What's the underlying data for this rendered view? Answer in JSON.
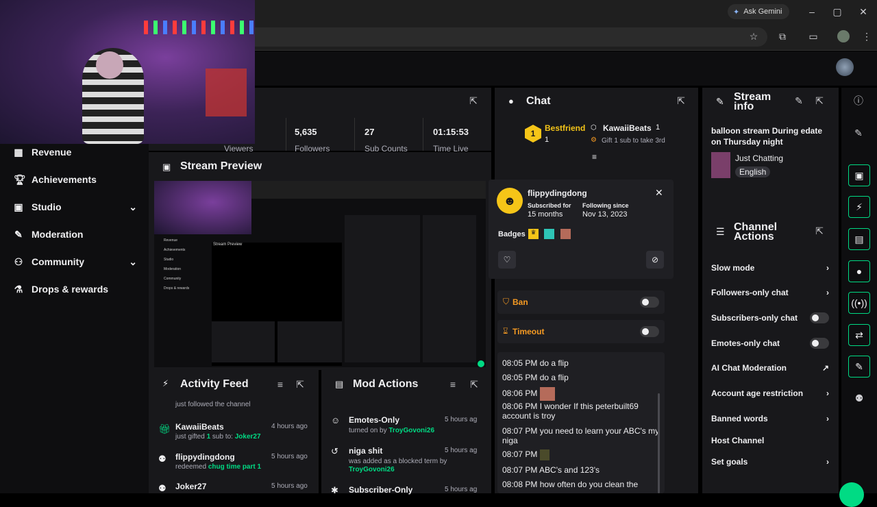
{
  "browser": {
    "ask_gemini": "Ask Gemini"
  },
  "sidebar": {
    "items": [
      {
        "label": "Revenue",
        "icon": "revenue-icon"
      },
      {
        "label": "Achievements",
        "icon": "trophy-icon"
      },
      {
        "label": "Studio",
        "icon": "studio-icon"
      },
      {
        "label": "Moderation",
        "icon": "wrench-icon"
      },
      {
        "label": "Community",
        "icon": "community-icon"
      },
      {
        "label": "Drops & rewards",
        "icon": "drops-icon"
      }
    ]
  },
  "stats": {
    "followers_num": "5,635",
    "subs_num": "27",
    "time_live": "01:15:53",
    "viewers_lbl": "Viewers",
    "followers_lbl": "Followers",
    "subs_lbl": "Sub Counts",
    "time_lbl": "Time Live"
  },
  "stream_preview": {
    "title": "Stream Preview"
  },
  "chat": {
    "title": "Chat",
    "pinned": {
      "rank": "1",
      "label": "Bestfriend",
      "count": "1",
      "user": "KawaiiBeats",
      "user_count": "1",
      "gift_text": "Gift 1 sub to take 3rd"
    }
  },
  "stream_info": {
    "title_line1": "Stream",
    "title_line2": "info",
    "stream_title": "balloon stream During edate on Thursday night",
    "category": "Just Chatting",
    "tag": "English"
  },
  "user_card": {
    "name": "flippydingdong",
    "sub_label": "Subscribed for",
    "sub_value": "15 months",
    "follow_label": "Following since",
    "follow_value": "Nov 13, 2023",
    "badges_label": "Badges",
    "ban_label": "Ban",
    "timeout_label": "Timeout"
  },
  "chat_log": [
    {
      "time": "08:05 PM",
      "text": "do a flip"
    },
    {
      "time": "08:05 PM",
      "text": "do a flip"
    },
    {
      "time": "08:06 PM",
      "text": ""
    },
    {
      "time": "08:06 PM",
      "text": "I wonder If this peterbuilt69 account is troy"
    },
    {
      "time": "08:07 PM",
      "text": "you need to learn your ABC's my niga"
    },
    {
      "time": "08:07 PM",
      "text": ""
    },
    {
      "time": "08:07 PM",
      "text": "ABC's and 123's"
    },
    {
      "time": "08:08 PM",
      "text": "how often do you clean the"
    }
  ],
  "channel_actions": {
    "title_line1": "Channel",
    "title_line2": "Actions",
    "items": [
      {
        "label": "Slow mode",
        "control": "chevron"
      },
      {
        "label": "Followers-only chat",
        "control": "chevron"
      },
      {
        "label": "Subscribers-only chat",
        "control": "toggle"
      },
      {
        "label": "Emotes-only chat",
        "control": "toggle"
      },
      {
        "label": "AI Chat Moderation",
        "control": "external"
      },
      {
        "label": "Account age restriction",
        "control": "chevron"
      },
      {
        "label": "Banned words",
        "control": "chevron"
      },
      {
        "label": "Host Channel",
        "control": "none"
      },
      {
        "label": "Set goals",
        "control": "chevron"
      }
    ]
  },
  "activity_feed": {
    "title": "Activity Feed",
    "partial_top": "just followed the channel",
    "items": [
      {
        "user": "KawaiiBeats",
        "time": "4 hours ago",
        "pre": "just gifted ",
        "count": "1",
        "mid": " sub to: ",
        "target": "Joker27"
      },
      {
        "user": "flippydingdong",
        "time": "5 hours ago",
        "pre": "redeemed ",
        "count": "",
        "mid": "",
        "target": "chug time part 1"
      },
      {
        "user": "Joker27",
        "time": "5 hours ago",
        "pre": "",
        "count": "",
        "mid": "",
        "target": ""
      }
    ]
  },
  "mod_actions": {
    "title": "Mod Actions",
    "items": [
      {
        "title": "Emotes-Only",
        "time": "5 hours ag",
        "pre": "turned on by ",
        "mod": "TroyGovoni26",
        "icon": "emote-icon"
      },
      {
        "title": "niga shit",
        "time": "5 hours ag",
        "pre": "was added as a blocked term by",
        "mod": "TroyGovoni26",
        "icon": "undo-icon"
      },
      {
        "title": "Subscriber-Only",
        "time": "5 hours ag",
        "pre": "",
        "mod": "",
        "icon": "star-icon"
      }
    ]
  },
  "colors": {
    "accent": "#00db84",
    "bg": "#0e0e10",
    "panel": "#18181b",
    "gold": "#f5c518"
  }
}
